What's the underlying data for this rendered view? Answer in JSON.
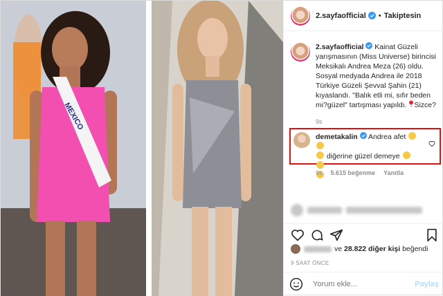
{
  "header": {
    "username": "2.sayfaofficial",
    "separator": "•",
    "follow_label": "Takiptesin"
  },
  "caption": {
    "username": "2.sayfaofficial",
    "text": "Kainat Güzeli yarışmasının (Miss Universe) birincisi Meksikalı Andrea Meza (26) oldu. Sosyal medyada Andrea ile 2018 Türkiye Güzeli Şevval Şahin (21) kıyaslandı. \"Balık etli mi, sıfır beden mi?güzel\" tartışması yapıldı.",
    "text_after_pin": "Sizce?",
    "time": "9s"
  },
  "comment": {
    "username": "demetakalin",
    "text_part1": "Andrea afet",
    "text_part2": "diğerine güzel demeye",
    "time": "9s",
    "likes": "5.615 beğenme",
    "reply_label": "Yanıtla",
    "highlight_color": "#e01010"
  },
  "likes": {
    "connector": "ve",
    "count_text": "28.822 diğer kişi",
    "suffix": "beğendi"
  },
  "age": "9 SAAT ÖNCE",
  "add_comment": {
    "placeholder": "Yorum ekle...",
    "post_label": "Paylaş"
  },
  "icons": {
    "verified": "verified-badge-icon",
    "heart": "heart-icon",
    "comment": "comment-icon",
    "share": "share-icon",
    "save": "bookmark-icon",
    "emoji": "emoji-icon"
  }
}
